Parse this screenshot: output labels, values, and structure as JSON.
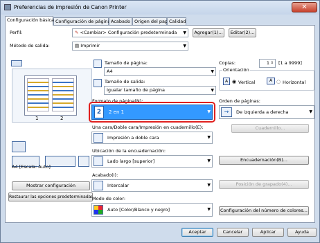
{
  "window": {
    "title": "Preferencias de impresión de Canon Printer",
    "close_symbol": "✕"
  },
  "tabs": [
    {
      "label": "Configuración básica"
    },
    {
      "label": "Configuración de página"
    },
    {
      "label": "Acabado"
    },
    {
      "label": "Origen del papel"
    },
    {
      "label": "Calidad"
    }
  ],
  "profile": {
    "label": "Perfil:",
    "value": "<Cambiar> Configuración predeterminada",
    "add_label": "Agregar(1)...",
    "edit_label": "Editar(2)..."
  },
  "output_method": {
    "label": "Método de salida:",
    "value": "Imprimir"
  },
  "page_size": {
    "label": "Tamaño de página:",
    "value": "A4"
  },
  "output_size": {
    "label": "Tamaño de salida:",
    "value": "Igualar tamaño de página"
  },
  "copies": {
    "label": "Copias:",
    "value": "1",
    "range": "[1 a 9999]"
  },
  "orientation": {
    "label": "Orientación",
    "portrait": "Vertical",
    "landscape": "Horizontal"
  },
  "page_format": {
    "label": "Formato de página(N):",
    "value": "2 en 1",
    "badge": "2"
  },
  "page_order": {
    "label": "Orden de páginas:",
    "value": "De izquierda a derecha"
  },
  "print_style": {
    "label": "Una cara/Doble cara/Impresión en cuadernillo(E):",
    "value": "Impresión a doble cara",
    "booklet_button": "Cuadernillo..."
  },
  "binding": {
    "label": "Ubicación de la encuadernación:",
    "value": "Lado largo [superior]",
    "binding_button": "Encuadernación(B)..."
  },
  "finishing": {
    "label": "Acabado(I):",
    "value": "Intercalar",
    "staple_button": "Posición de grapado(4)..."
  },
  "color_mode": {
    "label": "Modo de color:",
    "value": "Auto [Color/Blanco y negro]",
    "color_button": "Configuración del número de colores..."
  },
  "preview": {
    "scale_text": "A4 [Escala: Auto]",
    "page_numbers": [
      "1",
      "2"
    ]
  },
  "left_buttons": {
    "show_settings": "Mostrar configuración",
    "restore_defaults": "Restaurar las opciones predeterminadas"
  },
  "footer": {
    "ok": "Aceptar",
    "cancel": "Cancelar",
    "apply": "Aplicar",
    "help": "Ayuda"
  },
  "colors": {
    "highlight_frame": "#e0201e",
    "selected_combo_bg": "#3399ff"
  }
}
